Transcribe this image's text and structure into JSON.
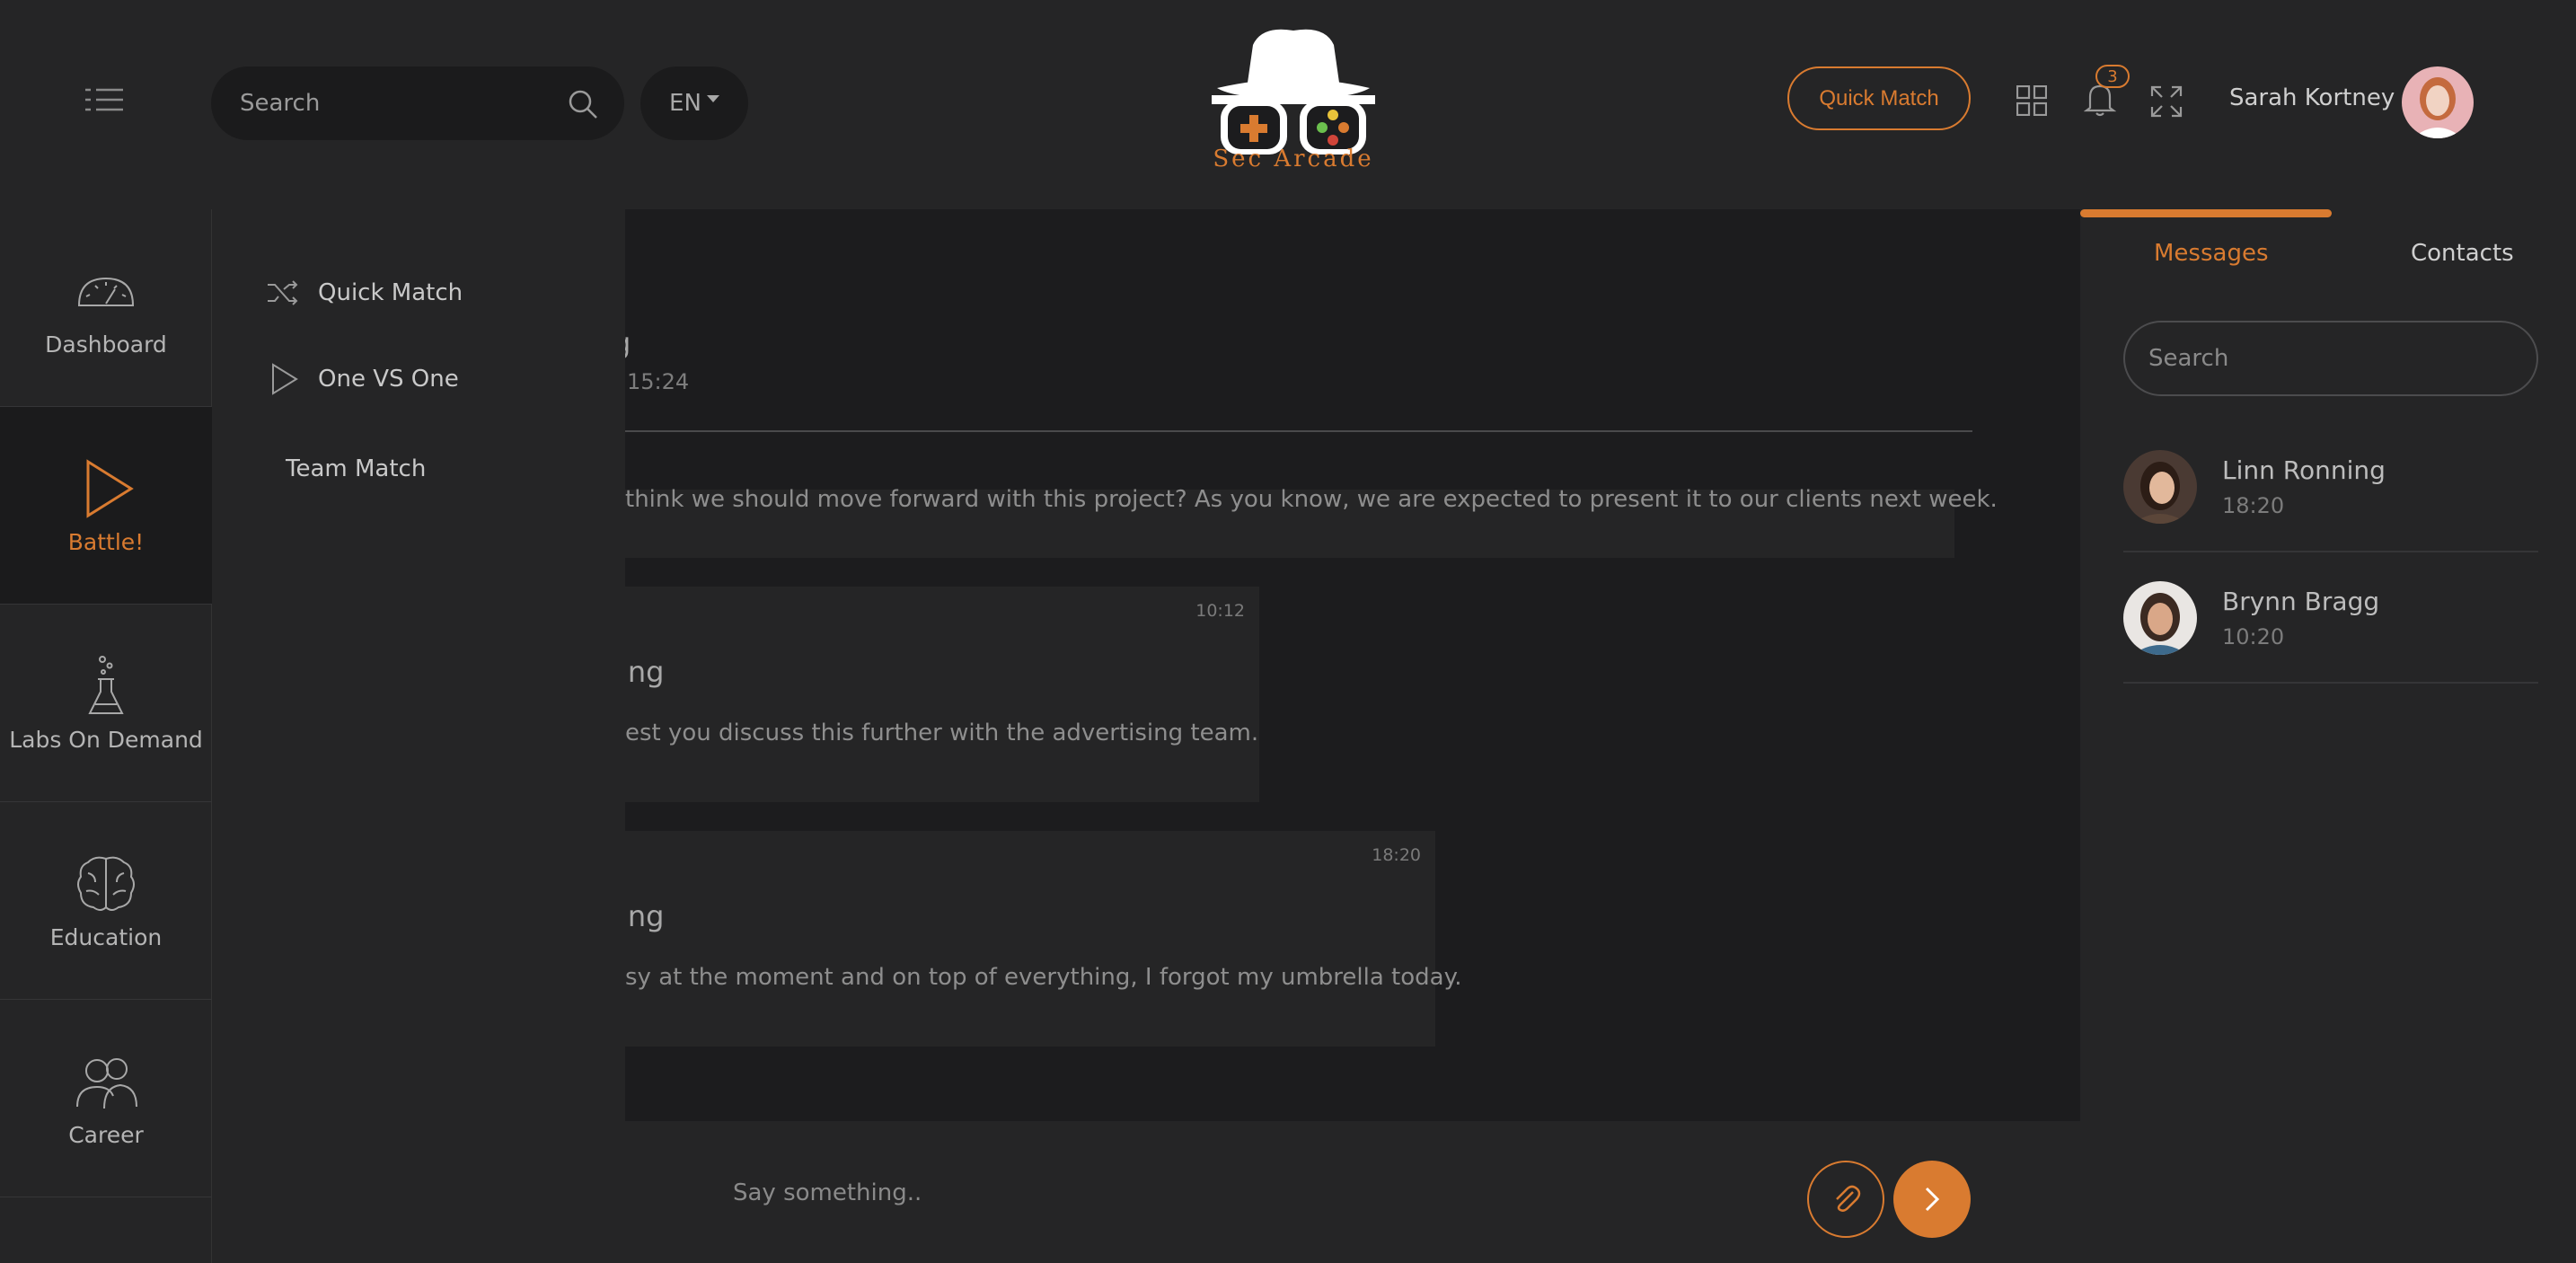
{
  "header": {
    "search_placeholder": "Search",
    "language": "EN",
    "brand": "Sec Arcade",
    "quick_match_label": "Quick Match",
    "notification_count": "3",
    "user_name": "Sarah Kortney"
  },
  "sidebar": {
    "items": [
      {
        "label": "Dashboard",
        "icon": "speedometer-icon"
      },
      {
        "label": "Battle!",
        "icon": "play-icon",
        "active": true
      },
      {
        "label": "Labs On Demand",
        "icon": "flask-icon"
      },
      {
        "label": "Education",
        "icon": "brain-icon"
      },
      {
        "label": "Career",
        "icon": "people-icon"
      }
    ]
  },
  "submenu": {
    "items": [
      {
        "label": "Quick Match",
        "icon": "shuffle-icon"
      },
      {
        "label": "One VS One",
        "icon": "play-outline-icon"
      },
      {
        "label": "Team Match"
      }
    ]
  },
  "chat": {
    "title": "g",
    "time": "15:24",
    "messages": [
      {
        "text": "think we should move forward with this project? As you know, we are expected to present it to our clients next week."
      },
      {
        "time": "10:12",
        "name": "ing",
        "text": "est you discuss this further with the advertising team."
      },
      {
        "time": "18:20",
        "name": "ing",
        "text": "sy at the moment and on top of everything, I forgot my umbrella today."
      }
    ],
    "composer_placeholder": "Say something.."
  },
  "right_panel": {
    "tabs": [
      "Messages",
      "Contacts"
    ],
    "search_placeholder": "Search",
    "contacts": [
      {
        "name": "Linn Ronning",
        "time": "18:20"
      },
      {
        "name": "Brynn Bragg",
        "time": "10:20"
      }
    ]
  },
  "colors": {
    "accent": "#d97b30",
    "panel": "#252526",
    "background": "#1c1c1e"
  }
}
